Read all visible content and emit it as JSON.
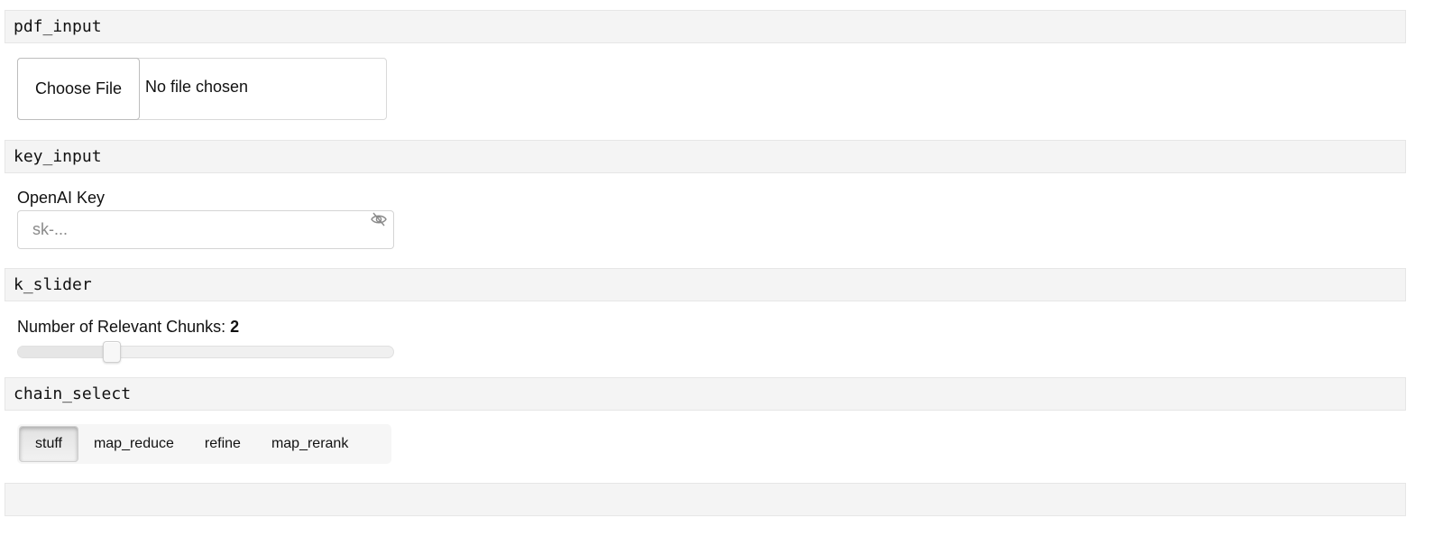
{
  "sections": {
    "pdf_input": "pdf_input",
    "key_input": "key_input",
    "k_slider": "k_slider",
    "chain_select": "chain_select",
    "empty": ""
  },
  "file_input": {
    "button_label": "Choose File",
    "status_text": "No file chosen"
  },
  "key_field": {
    "label": "OpenAI Key",
    "placeholder": "sk-...",
    "value": "",
    "toggle_icon": "eye-off-icon"
  },
  "slider": {
    "label": "Number of Relevant Chunks: ",
    "value": "2",
    "min": 0,
    "max": 8,
    "fraction": 0.25
  },
  "chain_options": {
    "items": [
      "stuff",
      "map_reduce",
      "refine",
      "map_rerank"
    ],
    "selected": "stuff"
  }
}
